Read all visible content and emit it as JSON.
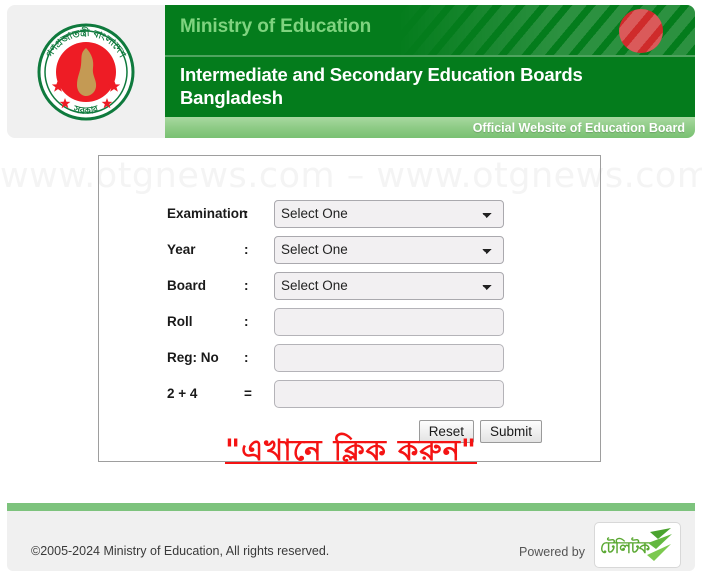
{
  "header": {
    "ministry_title": "Ministry of Education",
    "board_title": "Intermediate and Secondary Education Boards Bangladesh",
    "official_text": "Official Website of Education Board",
    "emblem_icon": "bangladesh-government-emblem",
    "flag_circle_icon": "bangladesh-flag-circle",
    "colors": {
      "band_green": "#047c1c",
      "ministry_text": "#7fd37f",
      "strip_green": "#8ecb86",
      "flag_red": "#cf2b2b"
    }
  },
  "watermark": {
    "text": "www.otgnews.com  –  www.otgnews.com"
  },
  "form": {
    "rows": [
      {
        "label": "Examination",
        "separator": ":",
        "type": "select",
        "value": "Select One"
      },
      {
        "label": "Year",
        "separator": ":",
        "type": "select",
        "value": "Select One"
      },
      {
        "label": "Board",
        "separator": ":",
        "type": "select",
        "value": "Select One"
      },
      {
        "label": "Roll",
        "separator": ":",
        "type": "text",
        "value": "",
        "placeholder": ""
      },
      {
        "label": "Reg: No",
        "separator": ":",
        "type": "text",
        "value": "",
        "placeholder": ""
      },
      {
        "label": "2 + 4",
        "separator": "=",
        "type": "text",
        "value": "",
        "placeholder": ""
      }
    ],
    "select_placeholder": "Select One",
    "reset_label": "Reset",
    "submit_label": "Submit"
  },
  "cta": {
    "text": "\"এখানে ক্লিক করুন\"",
    "color": "#f41313"
  },
  "footer": {
    "copyright": "©2005-2024 Ministry of Education, All rights reserved.",
    "powered_by": "Powered by",
    "logo_text": "টেলিটক",
    "logo_icon": "teletalk-logo",
    "bar_color": "#7dc37d"
  }
}
